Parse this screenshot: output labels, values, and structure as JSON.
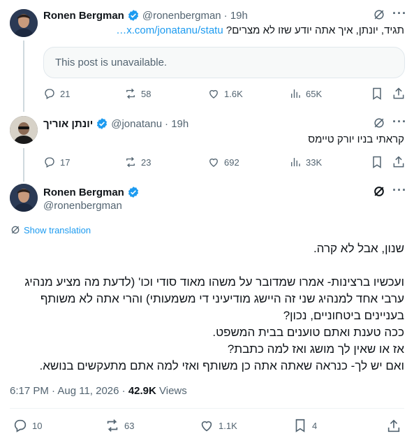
{
  "tweet1": {
    "name": "Ronen Bergman",
    "handle": "@ronenbergman",
    "time": "· 19h",
    "text": "תגיד, יונתן, איך אתה יודע שזו לא מצרים?",
    "link": "x.com/jonatanu/statu…",
    "quoted_unavailable": "This post is unavailable.",
    "replies": "21",
    "reposts": "58",
    "likes": "1.6K",
    "views": "65K"
  },
  "tweet2": {
    "name": "יונתן אוריך",
    "handle": "@jonatanu",
    "time": "· 19h",
    "text": "קראתי בניו יורק טיימס",
    "replies": "17",
    "reposts": "23",
    "likes": "692",
    "views": "33K"
  },
  "tweet3": {
    "name": "Ronen Bergman",
    "handle": "@ronenbergman",
    "show_translation": "Show translation",
    "paragraphs": [
      "שנון, אבל לא קרה.",
      "",
      "ועכשיו ברצינות- אמרו שמדובר על משהו מאוד סודי וכו' (לדעת מה מציע מנהיג ערבי אחד למנהיג שני זה היישג מודיעיני די משמעותי) והרי אתה לא משותף בעניינים ביטחוניים, נכון?",
      "ככה טענת ואתם טוענים בבית המשפט.",
      "אז או שאין לך מושג ואז למה כתבת?",
      "ואם יש לך- כנראה שאתה אתה כן משותף ואזי למה אתם מתעקשים בנושא."
    ],
    "timestamp": "6:17 PM · Aug 11, 2026 · ",
    "views_count": "42.9K",
    "views_label": " Views",
    "replies": "10",
    "reposts": "63",
    "likes": "1.1K",
    "bookmarks": "4"
  },
  "colors": {
    "accent": "#1d9bf0",
    "muted": "#536471",
    "text": "#0f1419"
  }
}
